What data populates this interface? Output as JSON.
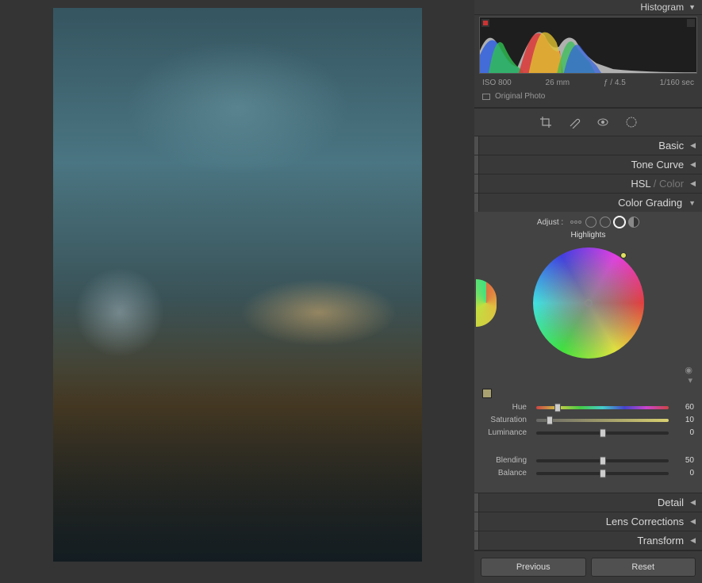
{
  "panels": {
    "histogram": {
      "title": "Histogram"
    },
    "basic": {
      "title": "Basic"
    },
    "tone_curve": {
      "title": "Tone Curve"
    },
    "hsl": {
      "title_prefix": "HSL",
      "title_suffix": " / Color"
    },
    "color_grading": {
      "title": "Color Grading"
    },
    "detail": {
      "title": "Detail"
    },
    "lens": {
      "title": "Lens Corrections"
    },
    "transform": {
      "title": "Transform"
    }
  },
  "meta": {
    "iso": "ISO 800",
    "focal": "26 mm",
    "aperture": "ƒ / 4.5",
    "shutter": "1/160 sec",
    "original": "Original Photo"
  },
  "color_grading": {
    "adjust_label": "Adjust :",
    "active_mode": "Highlights",
    "hue": {
      "label": "Hue",
      "value": 60,
      "pct": 16
    },
    "saturation": {
      "label": "Saturation",
      "value": 10,
      "pct": 10
    },
    "luminance": {
      "label": "Luminance",
      "value": 0,
      "pct": 50
    },
    "blending": {
      "label": "Blending",
      "value": 50,
      "pct": 50
    },
    "balance": {
      "label": "Balance",
      "value": 0,
      "pct": 50
    }
  },
  "buttons": {
    "previous": "Previous",
    "reset": "Reset"
  }
}
